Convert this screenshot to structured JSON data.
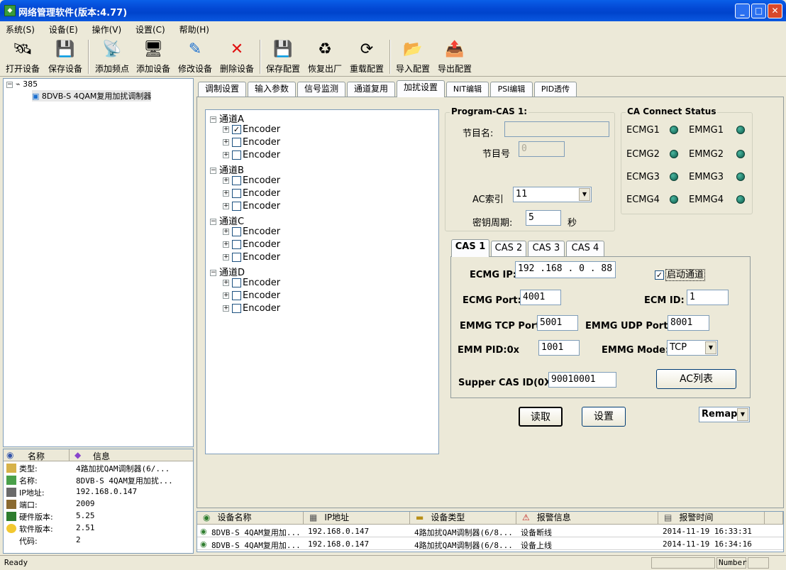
{
  "window": {
    "title": "网络管理软件(版本:4.77)",
    "icon": "app-icon"
  },
  "menu": [
    "系统(S)",
    "设备(E)",
    "操作(V)",
    "设置(C)",
    "帮助(H)"
  ],
  "toolbar": [
    {
      "label": "打开设备",
      "icon": "open-device-icon",
      "glyph": "🛰"
    },
    {
      "label": "保存设备",
      "icon": "save-device-icon",
      "glyph": "💾"
    },
    {
      "label": "添加频点",
      "icon": "add-frequency-icon",
      "glyph": "📡"
    },
    {
      "label": "添加设备",
      "icon": "add-device-icon",
      "glyph": "🖥"
    },
    {
      "label": "修改设备",
      "icon": "modify-device-icon",
      "glyph": "✎"
    },
    {
      "label": "删除设备",
      "icon": "delete-device-icon",
      "glyph": "✕"
    },
    {
      "label": "保存配置",
      "icon": "save-config-icon",
      "glyph": "💾"
    },
    {
      "label": "恢复出厂",
      "icon": "restore-factory-icon",
      "glyph": "♻"
    },
    {
      "label": "重载配置",
      "icon": "reload-config-icon",
      "glyph": "⟳"
    },
    {
      "label": "导入配置",
      "icon": "import-config-icon",
      "glyph": "📂"
    },
    {
      "label": "导出配置",
      "icon": "export-config-icon",
      "glyph": "📤"
    }
  ],
  "device_tree": {
    "root": "385",
    "child": "8DVB-S 4QAM复用加扰调制器"
  },
  "info_panel": {
    "headers": [
      "名称",
      "信息"
    ],
    "rows": [
      {
        "key": "类型:",
        "value": "4路加扰QAM调制器(6/..."
      },
      {
        "key": "名称:",
        "value": "8DVB-S 4QAM复用加扰..."
      },
      {
        "key": "IP地址:",
        "value": "192.168.0.147"
      },
      {
        "key": "端口:",
        "value": "2009"
      },
      {
        "key": "硬件版本:",
        "value": "5.25"
      },
      {
        "key": "软件版本:",
        "value": "2.51"
      },
      {
        "key": "代码:",
        "value": "2"
      }
    ]
  },
  "main_tabs": [
    "调制设置",
    "输入参数",
    "信号监测",
    "通道复用",
    "加扰设置",
    "NIT编辑",
    "PSI编辑",
    "PID透传"
  ],
  "active_tab": "加扰设置",
  "channels": [
    {
      "name": "通道A",
      "encoders": [
        {
          "label": "Encoder",
          "checked": "✓"
        },
        {
          "label": "Encoder",
          "checked": ""
        },
        {
          "label": "Encoder",
          "checked": ""
        }
      ]
    },
    {
      "name": "通道B",
      "encoders": [
        {
          "label": "Encoder",
          "checked": ""
        },
        {
          "label": "Encoder",
          "checked": ""
        },
        {
          "label": "Encoder",
          "checked": ""
        }
      ]
    },
    {
      "name": "通道C",
      "encoders": [
        {
          "label": "Encoder",
          "checked": ""
        },
        {
          "label": "Encoder",
          "checked": ""
        },
        {
          "label": "Encoder",
          "checked": ""
        }
      ]
    },
    {
      "name": "通道D",
      "encoders": [
        {
          "label": "Encoder",
          "checked": ""
        },
        {
          "label": "Encoder",
          "checked": ""
        },
        {
          "label": "Encoder",
          "checked": ""
        }
      ]
    }
  ],
  "program_cas": {
    "title": "Program-CAS 1:",
    "program_name_label": "节目名:",
    "program_name": "",
    "program_num_label": "节目号",
    "program_num": "0",
    "ac_index_label": "AC索引",
    "ac_index": "11",
    "key_period_label": "密钥周期:",
    "key_period": "5",
    "key_period_unit": "秒"
  },
  "ca_status": {
    "title": "CA Connect Status",
    "items": [
      {
        "ecmg": "ECMG1",
        "emmg": "EMMG1"
      },
      {
        "ecmg": "ECMG2",
        "emmg": "EMMG2"
      },
      {
        "ecmg": "ECMG3",
        "emmg": "EMMG3"
      },
      {
        "ecmg": "ECMG4",
        "emmg": "EMMG4"
      }
    ],
    "dot_color": "#1a7a66"
  },
  "cas_tabs": [
    "CAS 1",
    "CAS 2",
    "CAS 3",
    "CAS 4"
  ],
  "cas": {
    "ecmg_ip_label": "ECMG IP:",
    "ecmg_ip": "192 .168 . 0  . 88",
    "enable_label": "启动通道",
    "enable_checked": "✓",
    "ecmg_port_label": "ECMG Port:",
    "ecmg_port": "4001",
    "ecm_id_label": "ECM ID:",
    "ecm_id": "1",
    "emmg_tcp_label": "EMMG TCP Port:",
    "emmg_tcp": "5001",
    "emmg_udp_label": "EMMG UDP Port:",
    "emmg_udp": "8001",
    "emm_pid_label": "EMM PID:0x",
    "emm_pid": "1001",
    "emmg_mode_label": "EMMG Mode:",
    "emmg_mode": "TCP",
    "super_cas_label": "Supper CAS ID(0X):",
    "super_cas": "90010001",
    "ac_list_button": "AC列表"
  },
  "actions": {
    "read": "读取",
    "set": "设置",
    "remap": "Remap"
  },
  "alarm_list": {
    "headers": [
      "设备名称",
      "IP地址",
      "设备类型",
      "报警信息",
      "报警时间"
    ],
    "rows": [
      {
        "name": "8DVB-S 4QAM复用加...",
        "ip": "192.168.0.147",
        "type": "4路加扰QAM调制器(6/8...",
        "alarm": "设备断线",
        "time": "2014-11-19 16:33:31"
      },
      {
        "name": "8DVB-S 4QAM复用加...",
        "ip": "192.168.0.147",
        "type": "4路加扰QAM调制器(6/8...",
        "alarm": "设备上线",
        "time": "2014-11-19 16:34:16"
      }
    ]
  },
  "status": {
    "left": "Ready",
    "right": "Number"
  }
}
